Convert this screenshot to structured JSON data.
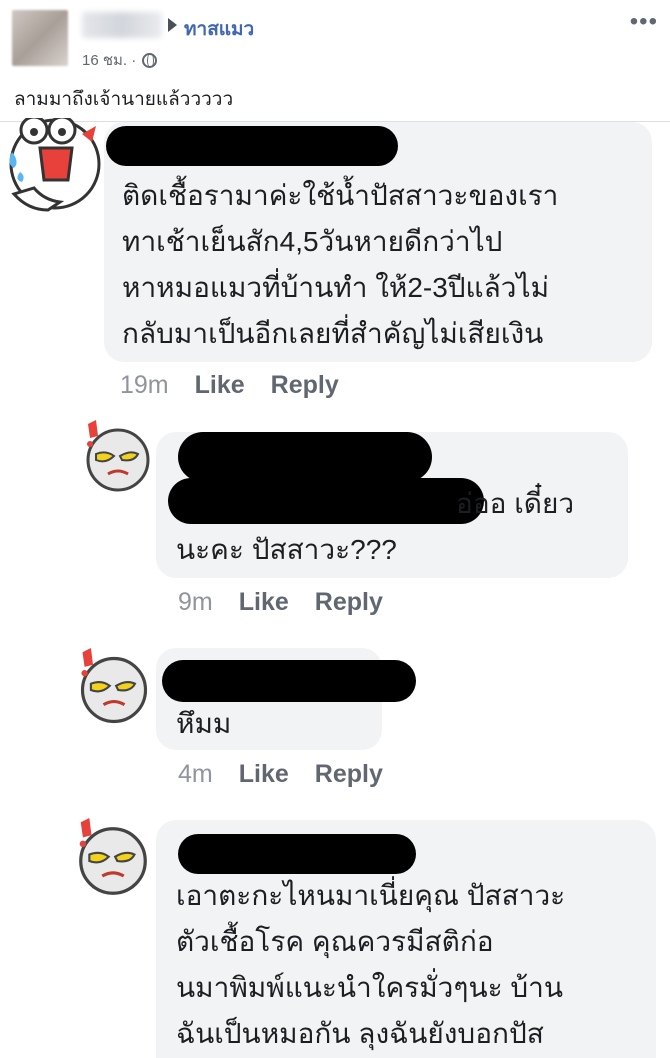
{
  "post": {
    "group_name": "ทาสแมว",
    "time": "16 ชม. ·",
    "text": "ลามมาถึงเจ้านายแล้ววววว",
    "more_icon": "more-horizontal-icon",
    "privacy_icon": "globe-icon"
  },
  "comments": [
    {
      "lines": [
        "ติดเชื้อรามาค่ะใช้น้ำปัสสาวะของเรา",
        "ทาเช้าเย็นสัก4,5วันหายดีกว่าไป",
        "หาหมอแมวที่บ้านทำ ให้2-3ปีแล้วไม่",
        "กลับมาเป็นอีกเลยที่สำคัญไม่เสียเงิน"
      ],
      "time": "19m",
      "like": "Like",
      "reply": "Reply"
    },
    {
      "lines": [
        "อ่ออ เดี๋ยว",
        "นะคะ ปัสสาวะ???"
      ],
      "time": "9m",
      "like": "Like",
      "reply": "Reply"
    },
    {
      "lines": [
        "หึมม"
      ],
      "time": "4m",
      "like": "Like",
      "reply": "Reply"
    },
    {
      "lines": [
        "เอาตะกะไหนมาเนี่ยคุณ ปัสสาวะ",
        "ตัวเชื้อโรค คุณควรมีสติก่อ",
        "นมาพิมพ์แนะนำใครมั่วๆนะ บ้าน",
        "ฉันเป็นหมอกัน ลุงฉันยังบอกปัส"
      ]
    }
  ],
  "colors": {
    "link": "#4267b2",
    "bubble": "#f2f3f5",
    "redaction": "#000000",
    "meta": "#606770"
  }
}
